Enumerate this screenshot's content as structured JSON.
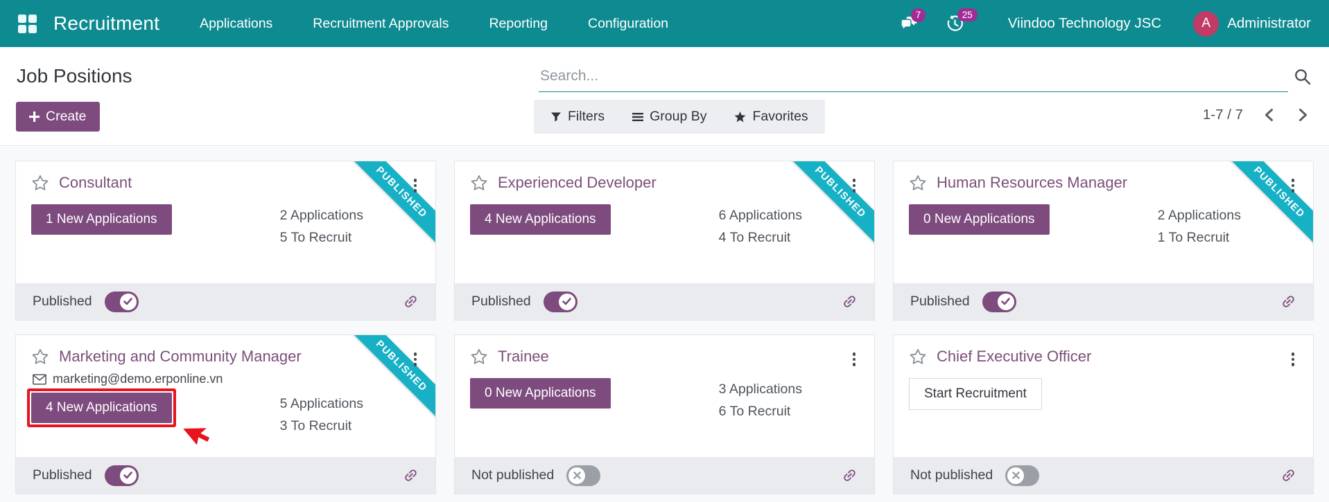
{
  "navbar": {
    "brand": "Recruitment",
    "menus": [
      "Applications",
      "Recruitment Approvals",
      "Reporting",
      "Configuration"
    ],
    "messages_badge": "7",
    "activities_badge": "25",
    "company": "Viindoo Technology JSC",
    "user_initial": "A",
    "user_name": "Administrator"
  },
  "header": {
    "title": "Job Positions",
    "search_placeholder": "Search...",
    "search_value": "",
    "create_label": "Create",
    "filters_label": "Filters",
    "group_by_label": "Group By",
    "favorites_label": "Favorites",
    "pager": "1-7 / 7"
  },
  "cards": [
    {
      "title": "Consultant",
      "action": "1 New Applications",
      "applications": "2 Applications",
      "to_recruit": "5 To Recruit",
      "ribbon": "PUBLISHED",
      "status_label": "Published",
      "published": true
    },
    {
      "title": "Experienced Developer",
      "action": "4 New Applications",
      "applications": "6 Applications",
      "to_recruit": "4 To Recruit",
      "ribbon": "PUBLISHED",
      "status_label": "Published",
      "published": true
    },
    {
      "title": "Human Resources Manager",
      "action": "0 New Applications",
      "applications": "2 Applications",
      "to_recruit": "1 To Recruit",
      "ribbon": "PUBLISHED",
      "status_label": "Published",
      "published": true
    },
    {
      "title": "Marketing and Community Manager",
      "email": "marketing@demo.erponline.vn",
      "action": "4 New Applications",
      "applications": "5 Applications",
      "to_recruit": "3 To Recruit",
      "ribbon": "PUBLISHED",
      "status_label": "Published",
      "published": true,
      "highlighted": true
    },
    {
      "title": "Trainee",
      "action": "0 New Applications",
      "applications": "3 Applications",
      "to_recruit": "6 To Recruit",
      "ribbon": null,
      "status_label": "Not published",
      "published": false
    },
    {
      "title": "Chief Executive Officer",
      "action": "Start Recruitment",
      "applications": null,
      "to_recruit": null,
      "ribbon": null,
      "status_label": "Not published",
      "published": false
    }
  ],
  "icons": {
    "apps": "grid-2x2",
    "messages": "speech-bubbles",
    "activities": "clock",
    "search": "magnifier",
    "filters": "funnel",
    "group_by": "bars",
    "favorites": "star-solid",
    "pager_prev": "chevron-left",
    "pager_next": "chevron-right",
    "favorite": "star-outline",
    "kebab": "vertical-dots",
    "email": "envelope",
    "publish_on": "check",
    "publish_off": "cross",
    "website_link": "chain-link",
    "tutorial_pointer": "red-arrow-cursor",
    "create_plus": "plus"
  },
  "colors": {
    "teal": "#0e8a91",
    "purple": "#7d4b7e",
    "purple-title": "#7b4f79",
    "ribbon": "#17b1c6",
    "badge": "#a42a96",
    "avatar": "#c23a66",
    "red": "#e8131d",
    "footer-bg": "#e9ebee",
    "filter-bg": "#eceef1",
    "text-dark": "#32373d",
    "text-stat": "#4e545b",
    "toggle-off": "#9aa0a6",
    "border": "#e2e5e9",
    "content-bg": "#f8f9fb"
  }
}
